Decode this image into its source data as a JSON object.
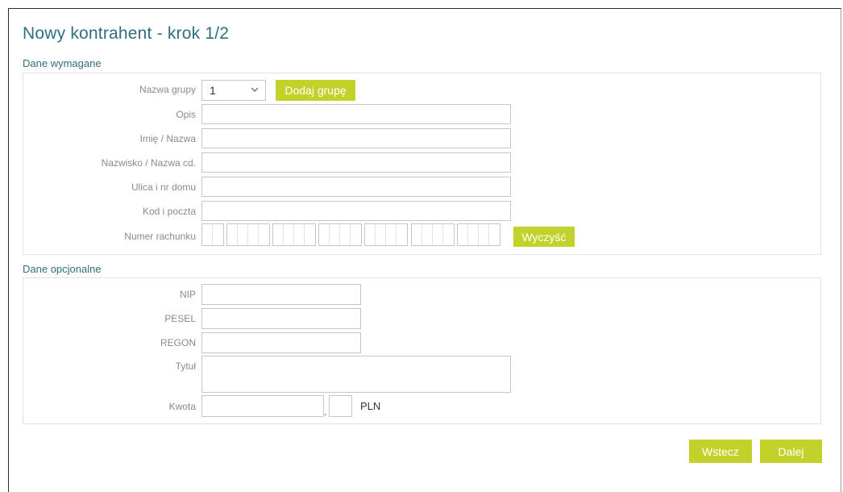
{
  "title": "Nowy kontrahent - krok 1/2",
  "required_section": {
    "heading": "Dane wymagane",
    "group_label": "Nazwa grupy",
    "group_selected": "1",
    "add_group_button": "Dodaj grupę",
    "fields": [
      {
        "label": "Opis",
        "value": ""
      },
      {
        "label": "Imię / Nazwa",
        "value": ""
      },
      {
        "label": "Nazwisko / Nazwa cd.",
        "value": ""
      },
      {
        "label": "Ulica i nr domu",
        "value": ""
      },
      {
        "label": "Kod i poczta",
        "value": ""
      }
    ],
    "account_label": "Numer rachunku",
    "clear_button": "Wyczyść"
  },
  "optional_section": {
    "heading": "Dane opcjonalne",
    "nip_label": "NIP",
    "pesel_label": "PESEL",
    "regon_label": "REGON",
    "title_label": "Tytuł",
    "amount_label": "Kwota",
    "amount_separator": ",",
    "currency": "PLN"
  },
  "footer": {
    "back_button": "Wstecz",
    "next_button": "Dalej"
  },
  "colors": {
    "accent_button": "#c3d12b",
    "heading": "#2f6f7f"
  },
  "icons": {
    "select_chevron": "chevron-down-icon"
  }
}
